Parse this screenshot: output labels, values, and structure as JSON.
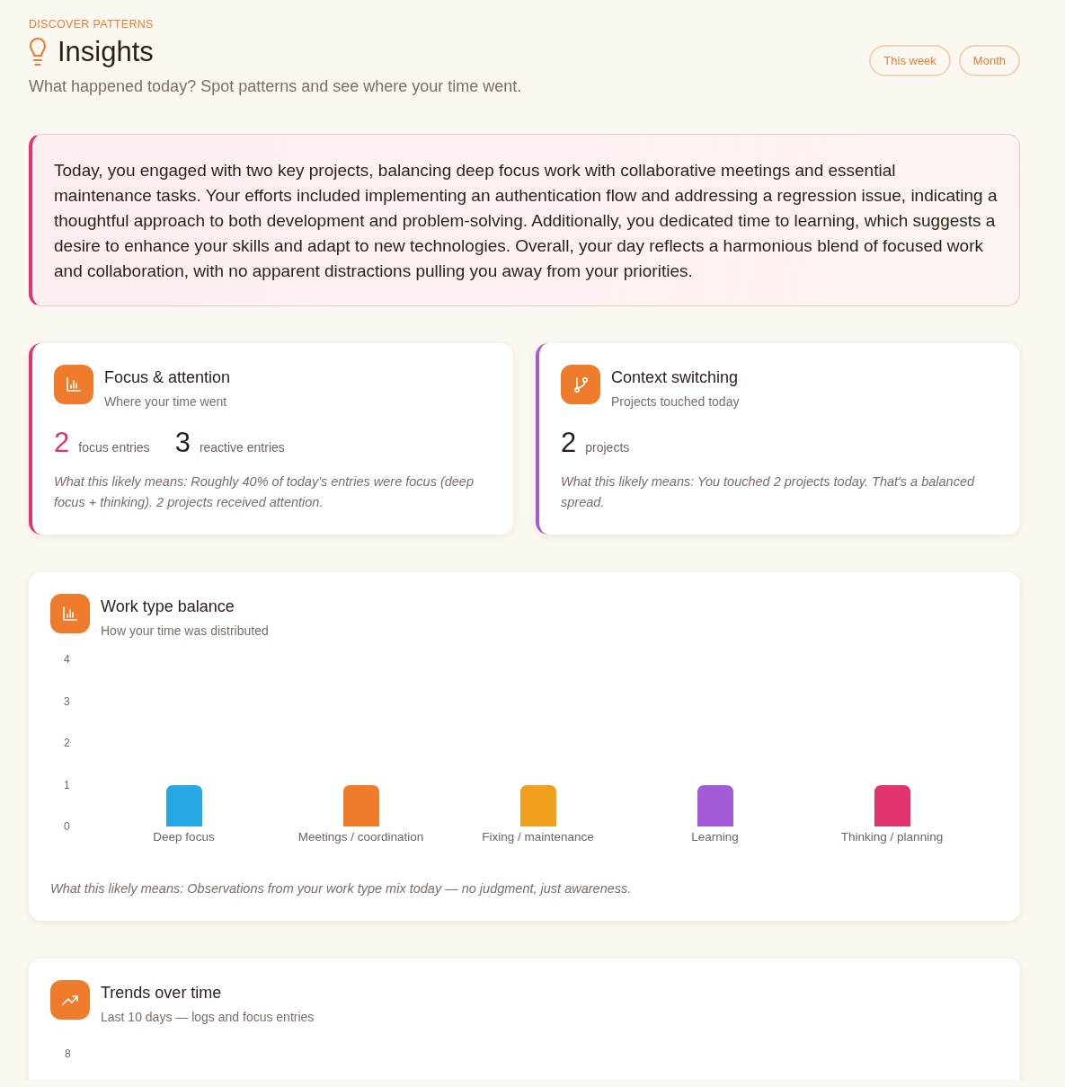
{
  "header": {
    "eyebrow": "DISCOVER PATTERNS",
    "title": "Insights",
    "subtitle": "What happened today? Spot patterns and see where your time went.",
    "ranges": [
      {
        "label": "This week",
        "selected": false
      },
      {
        "label": "Month",
        "selected": false
      }
    ]
  },
  "summary": {
    "text": "Today, you engaged with two key projects, balancing deep focus work with collaborative meetings and essential maintenance tasks. Your efforts included implementing an authentication flow and addressing a regression issue, indicating a thoughtful approach to both development and problem-solving. Additionally, you dedicated time to learning, which suggests a desire to enhance your skills and adapt to new technologies. Overall, your day reflects a harmonious blend of focused work and collaboration, with no apparent distractions pulling you away from your priorities."
  },
  "stat_cards": [
    {
      "color": "#e0336f",
      "title": "Focus & attention",
      "subtitle": "Where your time went",
      "stats": [
        {
          "value": "2",
          "label": "focus entries",
          "color": "#e0336f"
        },
        {
          "value": "3",
          "label": "reactive entries",
          "color": "#2a1f1a"
        }
      ],
      "note": "What this likely means: Roughly 40% of today's entries were focus (deep focus + thinking). 2 projects received attention."
    },
    {
      "color": "#a35ad6",
      "title": "Context switching",
      "subtitle": "Projects touched today",
      "stats": [
        {
          "value": "2",
          "label": "projects",
          "color": "#2a1f1a"
        }
      ],
      "note": "What this likely means: You touched 2 projects today. That's a balanced spread."
    }
  ],
  "work_type": {
    "title": "Work type balance",
    "subtitle": "How your time was distributed",
    "chart_data": {
      "type": "bar",
      "categories": [
        "Deep focus",
        "Meetings / coordination",
        "Fixing / maintenance",
        "Learning",
        "Thinking / planning"
      ],
      "series": [
        {
          "values": [
            1,
            1,
            1,
            1,
            1
          ]
        }
      ],
      "colors": [
        "#27a7e4",
        "#ef7c2c",
        "#f0a01c",
        "#a35ad6",
        "#e0336f"
      ],
      "ylim": [
        0,
        4
      ],
      "yticks": [
        0,
        1,
        2,
        3,
        4
      ]
    },
    "note": "What this likely means: Observations from your work type mix today — no judgment, just awareness."
  },
  "trends": {
    "title": "Trends over time",
    "subtitle": "Last 10 days — logs and focus entries",
    "axis_labels": [
      "8"
    ]
  }
}
